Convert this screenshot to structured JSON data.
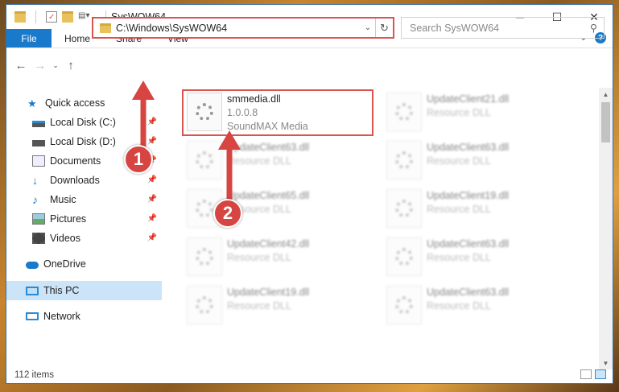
{
  "title": "SysWOW64",
  "ribbon": {
    "file": "File",
    "tabs": [
      "Home",
      "Share",
      "View"
    ]
  },
  "address": {
    "path": "C:\\Windows\\SysWOW64"
  },
  "search": {
    "placeholder": "Search SysWOW64"
  },
  "sidebar": {
    "items": [
      {
        "label": "Quick access",
        "icon": "star-icon"
      },
      {
        "label": "Local Disk (C:)",
        "icon": "drive-icon"
      },
      {
        "label": "Local Disk (D:)",
        "icon": "drive-icon"
      },
      {
        "label": "Documents",
        "icon": "documents-icon"
      },
      {
        "label": "Downloads",
        "icon": "downloads-icon"
      },
      {
        "label": "Music",
        "icon": "music-icon"
      },
      {
        "label": "Pictures",
        "icon": "pictures-icon"
      },
      {
        "label": "Videos",
        "icon": "videos-icon"
      },
      {
        "label": "OneDrive",
        "icon": "cloud-icon"
      },
      {
        "label": "This PC",
        "icon": "computer-icon"
      },
      {
        "label": "Network",
        "icon": "network-icon"
      }
    ]
  },
  "files": [
    {
      "name": "smmedia.dll",
      "version": "1.0.0.8",
      "desc": "SoundMAX Media"
    },
    {
      "name": "UpdateClient21.dll",
      "desc": "Resource DLL"
    },
    {
      "name": "UpdateClient63.dll",
      "desc": "Resource DLL"
    },
    {
      "name": "UpdateClient63.dll",
      "desc": "Resource DLL"
    },
    {
      "name": "UpdateClient65.dll",
      "desc": "Resource DLL"
    },
    {
      "name": "UpdateClient19.dll",
      "desc": "Resource DLL"
    },
    {
      "name": "UpdateClient42.dll",
      "desc": "Resource DLL"
    },
    {
      "name": "UpdateClient63.dll",
      "desc": "Resource DLL"
    },
    {
      "name": "UpdateClient19.dll",
      "desc": "Resource DLL"
    },
    {
      "name": "UpdateClient63.dll",
      "desc": "Resource DLL"
    }
  ],
  "status": {
    "items": "112 items"
  },
  "markers": {
    "one": "1",
    "two": "2"
  },
  "colors": {
    "accent": "#1979ca",
    "highlight": "#d9534f",
    "selected": "#cce4f7"
  }
}
